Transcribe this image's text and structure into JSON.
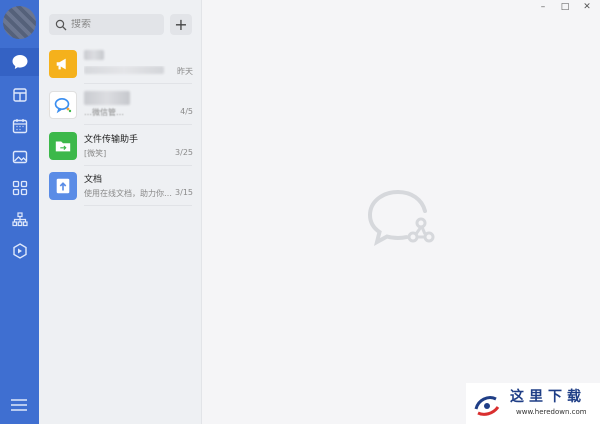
{
  "search": {
    "placeholder": "搜索"
  },
  "add_button": {
    "label": "+"
  },
  "chats": [
    {
      "name": "",
      "preview": "",
      "time": "昨天",
      "icon": "announcement-icon",
      "icon_bg": "#f5b11c"
    },
    {
      "name": "",
      "preview": "…微信管…",
      "time": "4/5",
      "icon": "wecom-icon",
      "icon_bg": "#ffffff"
    },
    {
      "name": "文件传输助手",
      "preview": "[微笑]",
      "time": "3/25",
      "icon": "folder-transfer-icon",
      "icon_bg": "#3cb84a"
    },
    {
      "name": "文档",
      "preview": "使用在线文档，助力你…",
      "time": "3/15",
      "icon": "document-icon",
      "icon_bg": "#5a8ce6"
    }
  ],
  "window_controls": {
    "minimize": "–",
    "maximize": "□",
    "close": "✕"
  },
  "watermark": {
    "text": "这里下载",
    "url": "www.heredown.com"
  },
  "colors": {
    "rail": "#3f6fd1",
    "list_bg": "#eef0f3",
    "main_bg": "#f5f5f7"
  }
}
